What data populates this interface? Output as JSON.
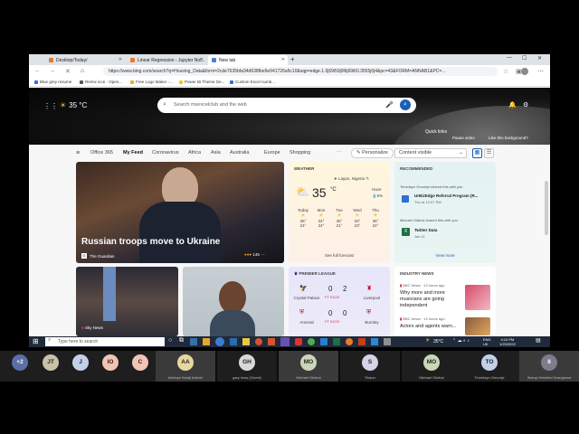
{
  "browser": {
    "tabs": [
      {
        "label": "Desktop/Today/",
        "color": "#e07a2e"
      },
      {
        "label": "Linear Regression - Jupyter Not...",
        "color": "#f37626"
      },
      {
        "label": "New tab",
        "color": "#4a7fd4"
      }
    ],
    "new_tab_glyph": "+",
    "address": "https://www.bing.com/search?q=Housing_Data&form=2cde7635bfa34d638fbe5e941726a5c10&sqp=edge.1.0j69i59j0l6j69i60.3555j0j4&pc=43&FORM=ANNAB1&PC=..."
  },
  "bookmarks": [
    {
      "label": "Blue grey resume",
      "color": "#2e6fd1"
    },
    {
      "label": "Remix icon · Open...",
      "color": "#555555"
    },
    {
      "label": "Free Logo Maker -...",
      "color": "#e0b030"
    },
    {
      "label": "Power BI Theme Ge...",
      "color": "#f2c811"
    },
    {
      "label": "Custom Excel numb...",
      "color": "#2e6fd1"
    }
  ],
  "hero": {
    "temperature": "35 °C",
    "search_placeholder": "Search msexcelclub and the web",
    "quick_links": "Quick links",
    "pause_video": "Pause video",
    "like_background": "Like this background?"
  },
  "feed": {
    "categories": [
      "Office 365",
      "My Feed",
      "Coronavirus",
      "Africa",
      "Asia",
      "Australia",
      "Europe",
      "Shopping"
    ],
    "active_category": "My Feed",
    "personalize": "Personalize",
    "content_visible": "Content visible",
    "main_story": {
      "headline": "Russian troops move to Ukraine",
      "source": "The Guardian",
      "reactions": "145"
    },
    "small_story_source": "Sky News",
    "weather": {
      "title": "WEATHER",
      "location": "Lagos, Nigeria",
      "temp": "35",
      "unit": "°C",
      "condition": "Haze",
      "precip": "6%",
      "days": [
        {
          "day": "Today",
          "high": "35°",
          "low": "24°"
        },
        {
          "day": "Mon",
          "high": "34°",
          "low": "24°"
        },
        {
          "day": "Tue",
          "high": "35°",
          "low": "21°"
        },
        {
          "day": "Wed",
          "high": "33°",
          "low": "23°"
        },
        {
          "day": "Thu",
          "high": "35°",
          "low": "24°"
        }
      ],
      "full_forecast": "See full forecast"
    },
    "recommended": {
      "title": "RECOMMENDED",
      "items": [
        {
          "who": "Temidayo Omoniyi shared this with you",
          "title": "UrBizEdge Referral Program (R...",
          "when": "Thu at 12:07 PM"
        },
        {
          "who": "Michael Olafusi shared this with you",
          "title": "Twitter Data",
          "when": "Jan 11"
        }
      ],
      "view_more": "View more"
    },
    "premier_league": {
      "title": "PREMIER LEAGUE",
      "matches": [
        {
          "home": "Crystal Palace",
          "home_score": "0",
          "away_score": "2",
          "away": "Liverpool",
          "status": "FT 01/23"
        },
        {
          "home": "Arsenal",
          "home_score": "0",
          "away_score": "0",
          "away": "Burnley",
          "status": "FT 01/23"
        }
      ]
    },
    "industry_news": {
      "title": "INDUSTRY NEWS",
      "items": [
        {
          "source": "BBC News · 13 hours ago",
          "headline": "Why more and more musicians are going independent"
        },
        {
          "source": "BBC News · 14 hours ago",
          "headline": "Actors and agents warn..."
        }
      ]
    }
  },
  "taskbar": {
    "search_placeholder": "Type here to search",
    "temperature": "35°C",
    "lang": "ENG",
    "region": "UK",
    "time": "4:10 PM",
    "date": "1/23/2022"
  },
  "participants": [
    {
      "initials": "+2",
      "name": "",
      "color": "#5b6ea8",
      "text": "#ffffff"
    },
    {
      "initials": "JT",
      "name": "",
      "color": "#c9c2a8",
      "text": "#222222"
    },
    {
      "initials": "J",
      "name": "",
      "color": "#c3d1e8",
      "text": "#222222"
    },
    {
      "initials": "IO",
      "name": "",
      "color": "#f2c4b4",
      "text": "#222222"
    },
    {
      "initials": "C",
      "name": "",
      "color": "#f2c4b4",
      "text": "#222222"
    },
    {
      "initials": "AA",
      "name": "Adeloye Bolaji Adeolu",
      "color": "#e8d79e",
      "text": "#222222"
    },
    {
      "initials": "GH",
      "name": "gary hess (Guest)",
      "color": "#d8d8d8",
      "text": "#222222"
    },
    {
      "initials": "MO",
      "name": "Michael Olafusi",
      "color": "#c9d6b8",
      "text": "#222222"
    },
    {
      "initials": "S",
      "name": "Shaun",
      "color": "#d7d2e6",
      "text": "#222222"
    },
    {
      "initials": "MO",
      "name": "Michael Olafusi",
      "color": "#c9d6b8",
      "text": "#222222"
    },
    {
      "initials": "TO",
      "name": "Temidayo Omoniyi",
      "color": "#c3d1e8",
      "text": "#222222"
    },
    {
      "initials": "II",
      "name": "Ifeanyi Ihimekici Ikwugwara",
      "color": "#7c7c8c",
      "text": "#ffffff"
    }
  ]
}
